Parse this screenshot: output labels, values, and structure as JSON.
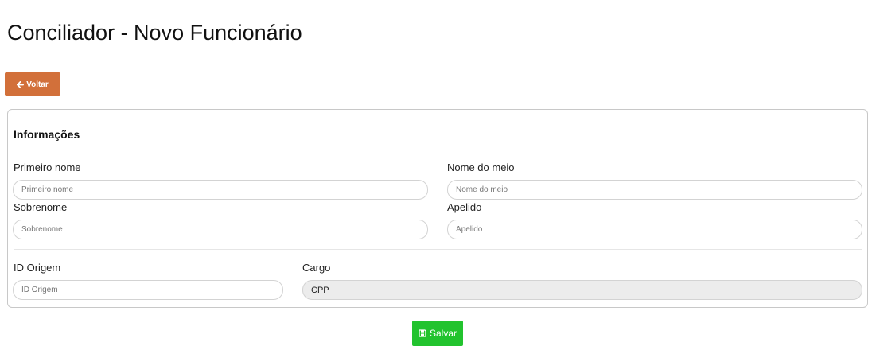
{
  "page": {
    "title": "Conciliador - Novo Funcionário"
  },
  "toolbar": {
    "back_label": "Voltar",
    "back_icon": "arrow-left-icon"
  },
  "form": {
    "section_title": "Informações",
    "first_name": {
      "label": "Primeiro nome",
      "placeholder": "Primeiro nome",
      "value": ""
    },
    "middle_name": {
      "label": "Nome do meio",
      "placeholder": "Nome do meio",
      "value": ""
    },
    "last_name": {
      "label": "Sobrenome",
      "placeholder": "Sobrenome",
      "value": ""
    },
    "nickname": {
      "label": "Apelido",
      "placeholder": "Apelido",
      "value": ""
    },
    "origin_id": {
      "label": "ID Origem",
      "placeholder": "ID Origem",
      "value": ""
    },
    "position": {
      "label": "Cargo",
      "value": "CPP"
    }
  },
  "actions": {
    "save_label": "Salvar",
    "save_icon": "floppy-disk-icon"
  },
  "colors": {
    "back_button": "#d2703a",
    "save_button": "#22c32e",
    "readonly_field": "#ececec"
  }
}
